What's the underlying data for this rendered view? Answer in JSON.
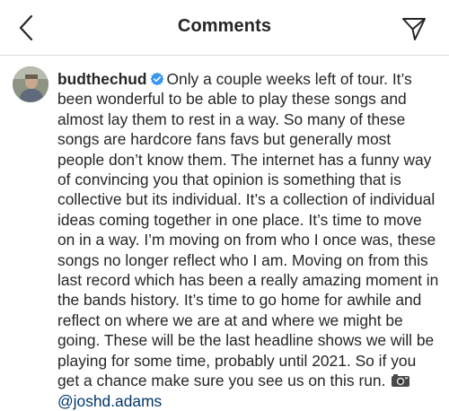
{
  "header": {
    "title": "Comments",
    "back_icon": "chevron-left-icon",
    "share_icon": "paper-plane-icon"
  },
  "comment": {
    "username": "budthechud",
    "verified": true,
    "text": "Only a couple weeks left of tour. It’s been wonderful to be able to play these songs and almost lay them to rest in a way. So many of these songs are hardcore fans favs but generally most people don’t know them. The internet has a funny way of convincing you that opinion is something that is collective but its individual. It’s a collection of individual ideas coming together in one place. It’s time to move on in a way. I’m moving on from who I once was, these songs no longer reflect who I am. Moving on from this last record which has been a really amazing moment in the bands history. It’s time to go home for awhile and reflect on where we are at and where we might be going. These will be the last headline shows we will be playing for some time, probably until 2021. So if you get a chance make sure you see us on this run.",
    "photo_credit_icon": "camera-icon",
    "mention": "@joshd.adams"
  },
  "colors": {
    "text": "#262626",
    "verified_badge": "#3897f0",
    "mention": "#00376b",
    "divider": "#dbdbdb"
  }
}
